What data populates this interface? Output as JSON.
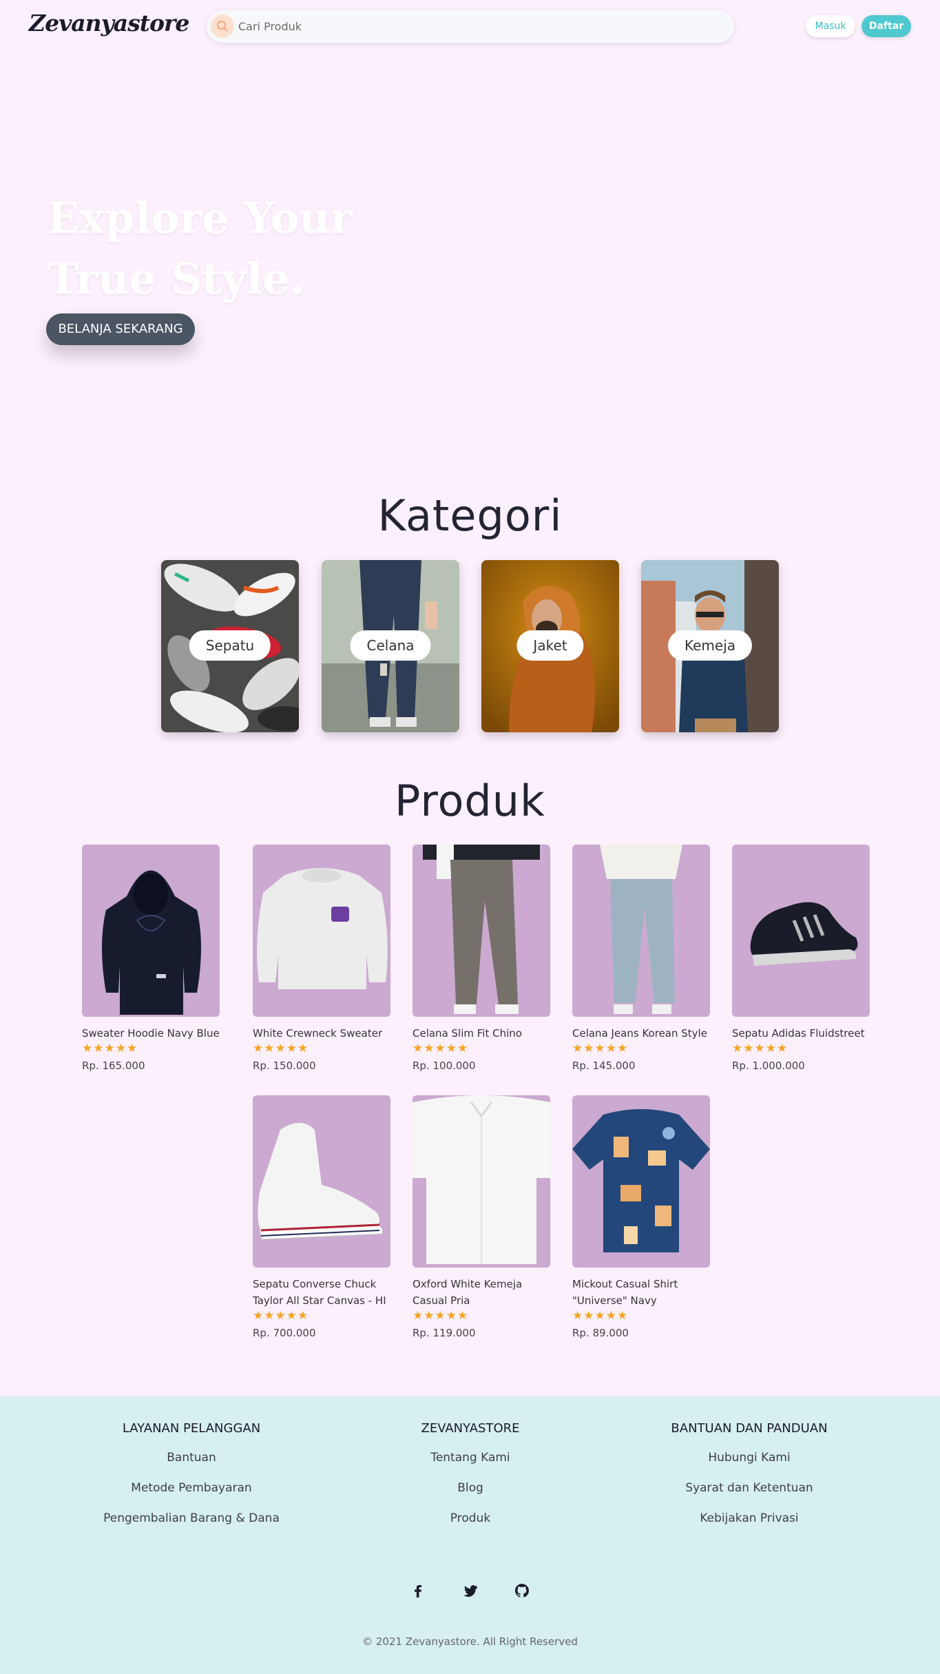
{
  "header": {
    "logo": "Zevanyastore",
    "search_placeholder": "Cari Produk",
    "login_label": "Masuk",
    "register_label": "Daftar"
  },
  "hero": {
    "title_line1": "Explore Your",
    "title_line2": "True Style.",
    "cta_label": "BELANJA SEKARANG"
  },
  "kategori": {
    "title": "Kategori",
    "items": [
      {
        "label": "Sepatu"
      },
      {
        "label": "Celana"
      },
      {
        "label": "Jaket"
      },
      {
        "label": "Kemeja"
      }
    ]
  },
  "produk": {
    "title": "Produk",
    "stars": "★★★★★",
    "items": [
      {
        "name": "Sweater Hoodie Navy Blue",
        "price": "Rp. 165.000"
      },
      {
        "name": "White Crewneck Sweater",
        "price": "Rp. 150.000"
      },
      {
        "name": "Celana Slim Fit Chino",
        "price": "Rp. 100.000"
      },
      {
        "name": "Celana Jeans Korean Style",
        "price": "Rp. 145.000"
      },
      {
        "name": "Sepatu Adidas Fluidstreet",
        "price": "Rp. 1.000.000"
      },
      {
        "name": "Sepatu Converse Chuck Taylor All Star Canvas - HI",
        "price": "Rp. 700.000"
      },
      {
        "name": "Oxford White Kemeja Casual Pria",
        "price": "Rp. 119.000"
      },
      {
        "name": "Mickout Casual Shirt \"Universe\" Navy",
        "price": "Rp. 89.000"
      }
    ]
  },
  "footer": {
    "columns": [
      {
        "title": "LAYANAN PELANGGAN",
        "links": [
          "Bantuan",
          "Metode Pembayaran",
          "Pengembalian Barang & Dana"
        ]
      },
      {
        "title": "ZEVANYASTORE",
        "links": [
          "Tentang Kami",
          "Blog",
          "Produk"
        ]
      },
      {
        "title": "BANTUAN DAN PANDUAN",
        "links": [
          "Hubungi Kami",
          "Syarat dan Ketentuan",
          "Kebijakan Privasi"
        ]
      }
    ],
    "social_icons": [
      "facebook-icon",
      "twitter-icon",
      "github-icon"
    ],
    "copyright": "© 2021 Zevanyastore. All Right Reserved"
  },
  "colors": {
    "page_bg": "#fdf0fd",
    "accent_teal": "#50c8cf",
    "hero_button": "#4b5563",
    "product_bg": "#cba9d0",
    "star": "#f5a523",
    "footer_bg": "#d6eff0"
  }
}
